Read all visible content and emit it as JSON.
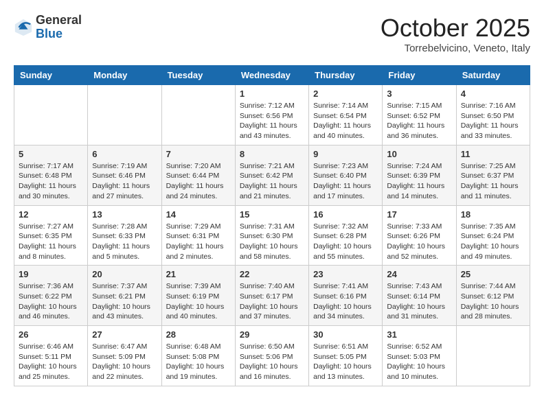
{
  "header": {
    "logo_general": "General",
    "logo_blue": "Blue",
    "month_title": "October 2025",
    "location": "Torrebelvicino, Veneto, Italy"
  },
  "calendar": {
    "days_of_week": [
      "Sunday",
      "Monday",
      "Tuesday",
      "Wednesday",
      "Thursday",
      "Friday",
      "Saturday"
    ],
    "weeks": [
      [
        {
          "day": "",
          "info": ""
        },
        {
          "day": "",
          "info": ""
        },
        {
          "day": "",
          "info": ""
        },
        {
          "day": "1",
          "info": "Sunrise: 7:12 AM\nSunset: 6:56 PM\nDaylight: 11 hours and 43 minutes."
        },
        {
          "day": "2",
          "info": "Sunrise: 7:14 AM\nSunset: 6:54 PM\nDaylight: 11 hours and 40 minutes."
        },
        {
          "day": "3",
          "info": "Sunrise: 7:15 AM\nSunset: 6:52 PM\nDaylight: 11 hours and 36 minutes."
        },
        {
          "day": "4",
          "info": "Sunrise: 7:16 AM\nSunset: 6:50 PM\nDaylight: 11 hours and 33 minutes."
        }
      ],
      [
        {
          "day": "5",
          "info": "Sunrise: 7:17 AM\nSunset: 6:48 PM\nDaylight: 11 hours and 30 minutes."
        },
        {
          "day": "6",
          "info": "Sunrise: 7:19 AM\nSunset: 6:46 PM\nDaylight: 11 hours and 27 minutes."
        },
        {
          "day": "7",
          "info": "Sunrise: 7:20 AM\nSunset: 6:44 PM\nDaylight: 11 hours and 24 minutes."
        },
        {
          "day": "8",
          "info": "Sunrise: 7:21 AM\nSunset: 6:42 PM\nDaylight: 11 hours and 21 minutes."
        },
        {
          "day": "9",
          "info": "Sunrise: 7:23 AM\nSunset: 6:40 PM\nDaylight: 11 hours and 17 minutes."
        },
        {
          "day": "10",
          "info": "Sunrise: 7:24 AM\nSunset: 6:39 PM\nDaylight: 11 hours and 14 minutes."
        },
        {
          "day": "11",
          "info": "Sunrise: 7:25 AM\nSunset: 6:37 PM\nDaylight: 11 hours and 11 minutes."
        }
      ],
      [
        {
          "day": "12",
          "info": "Sunrise: 7:27 AM\nSunset: 6:35 PM\nDaylight: 11 hours and 8 minutes."
        },
        {
          "day": "13",
          "info": "Sunrise: 7:28 AM\nSunset: 6:33 PM\nDaylight: 11 hours and 5 minutes."
        },
        {
          "day": "14",
          "info": "Sunrise: 7:29 AM\nSunset: 6:31 PM\nDaylight: 11 hours and 2 minutes."
        },
        {
          "day": "15",
          "info": "Sunrise: 7:31 AM\nSunset: 6:30 PM\nDaylight: 10 hours and 58 minutes."
        },
        {
          "day": "16",
          "info": "Sunrise: 7:32 AM\nSunset: 6:28 PM\nDaylight: 10 hours and 55 minutes."
        },
        {
          "day": "17",
          "info": "Sunrise: 7:33 AM\nSunset: 6:26 PM\nDaylight: 10 hours and 52 minutes."
        },
        {
          "day": "18",
          "info": "Sunrise: 7:35 AM\nSunset: 6:24 PM\nDaylight: 10 hours and 49 minutes."
        }
      ],
      [
        {
          "day": "19",
          "info": "Sunrise: 7:36 AM\nSunset: 6:22 PM\nDaylight: 10 hours and 46 minutes."
        },
        {
          "day": "20",
          "info": "Sunrise: 7:37 AM\nSunset: 6:21 PM\nDaylight: 10 hours and 43 minutes."
        },
        {
          "day": "21",
          "info": "Sunrise: 7:39 AM\nSunset: 6:19 PM\nDaylight: 10 hours and 40 minutes."
        },
        {
          "day": "22",
          "info": "Sunrise: 7:40 AM\nSunset: 6:17 PM\nDaylight: 10 hours and 37 minutes."
        },
        {
          "day": "23",
          "info": "Sunrise: 7:41 AM\nSunset: 6:16 PM\nDaylight: 10 hours and 34 minutes."
        },
        {
          "day": "24",
          "info": "Sunrise: 7:43 AM\nSunset: 6:14 PM\nDaylight: 10 hours and 31 minutes."
        },
        {
          "day": "25",
          "info": "Sunrise: 7:44 AM\nSunset: 6:12 PM\nDaylight: 10 hours and 28 minutes."
        }
      ],
      [
        {
          "day": "26",
          "info": "Sunrise: 6:46 AM\nSunset: 5:11 PM\nDaylight: 10 hours and 25 minutes."
        },
        {
          "day": "27",
          "info": "Sunrise: 6:47 AM\nSunset: 5:09 PM\nDaylight: 10 hours and 22 minutes."
        },
        {
          "day": "28",
          "info": "Sunrise: 6:48 AM\nSunset: 5:08 PM\nDaylight: 10 hours and 19 minutes."
        },
        {
          "day": "29",
          "info": "Sunrise: 6:50 AM\nSunset: 5:06 PM\nDaylight: 10 hours and 16 minutes."
        },
        {
          "day": "30",
          "info": "Sunrise: 6:51 AM\nSunset: 5:05 PM\nDaylight: 10 hours and 13 minutes."
        },
        {
          "day": "31",
          "info": "Sunrise: 6:52 AM\nSunset: 5:03 PM\nDaylight: 10 hours and 10 minutes."
        },
        {
          "day": "",
          "info": ""
        }
      ]
    ]
  }
}
